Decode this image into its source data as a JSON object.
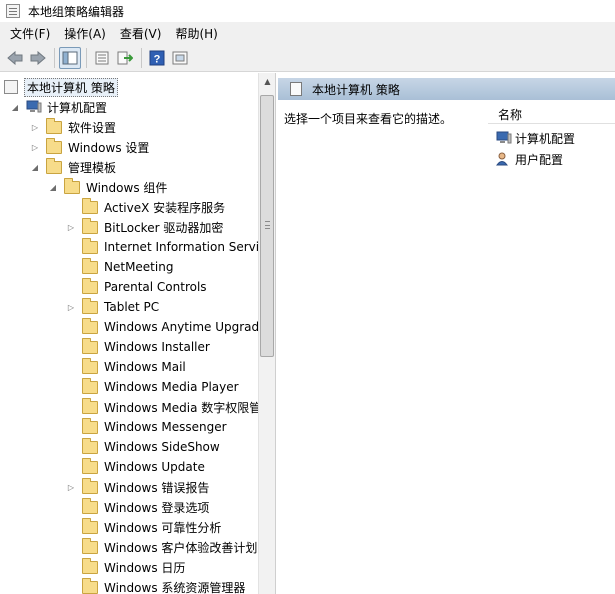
{
  "window": {
    "title": "本地组策略编辑器"
  },
  "menu": [
    "文件(F)",
    "操作(A)",
    "查看(V)",
    "帮助(H)"
  ],
  "toolbar": {
    "icons": [
      "back-icon",
      "forward-icon",
      "show-tree-icon",
      "properties-icon",
      "export-icon",
      "help-icon",
      "filter-icon"
    ]
  },
  "tree": {
    "root": "本地计算机 策略",
    "computer_config": "计算机配置",
    "software_settings": "软件设置",
    "windows_settings": "Windows 设置",
    "admin_templates": "管理模板",
    "windows_components": "Windows 组件",
    "items": [
      "ActiveX 安装程序服务",
      "BitLocker 驱动器加密",
      "Internet Information Services",
      "NetMeeting",
      "Parental Controls",
      "Tablet PC",
      "Windows Anytime Upgrade",
      "Windows Installer",
      "Windows Mail",
      "Windows Media Player",
      "Windows Media 数字权限管理",
      "Windows Messenger",
      "Windows SideShow",
      "Windows Update",
      "Windows 错误报告",
      "Windows 登录选项",
      "Windows 可靠性分析",
      "Windows 客户体验改善计划",
      "Windows 日历",
      "Windows 系统资源管理器"
    ]
  },
  "detail": {
    "header": "本地计算机 策略",
    "description": "选择一个项目来查看它的描述。",
    "column_name": "名称",
    "items": [
      "计算机配置",
      "用户配置"
    ]
  }
}
